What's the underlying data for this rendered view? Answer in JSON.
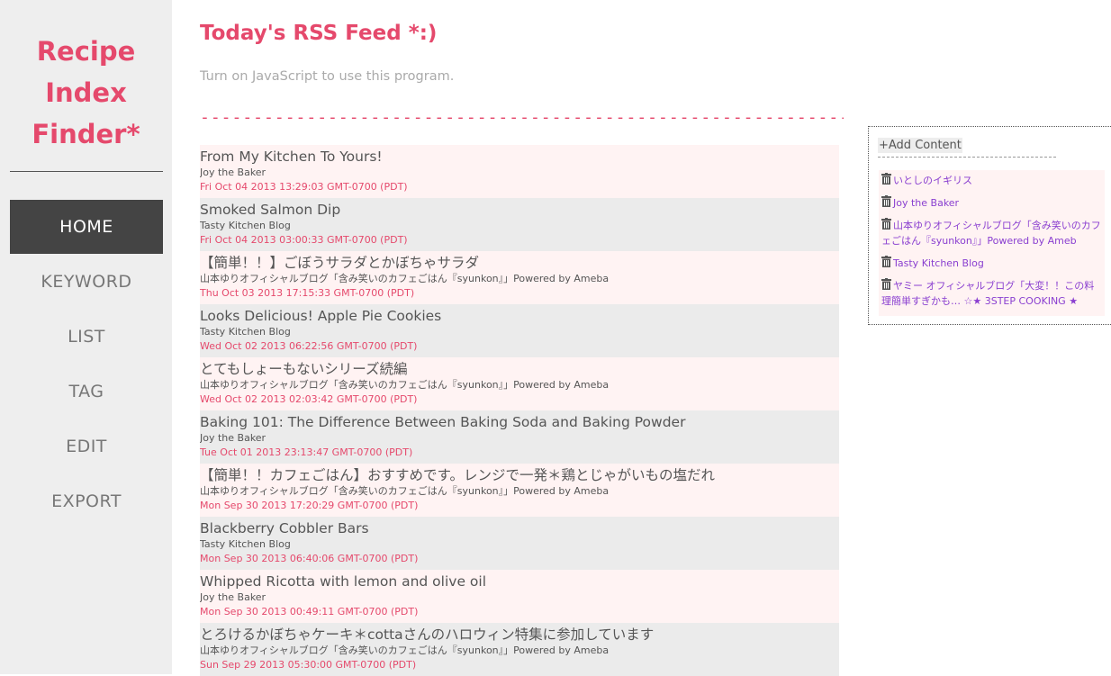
{
  "sidebar": {
    "logo_lines": [
      "Recipe",
      "Index",
      "Finder*"
    ],
    "nav": [
      {
        "label": "HOME",
        "active": true
      },
      {
        "label": "KEYWORD",
        "active": false
      },
      {
        "label": "LIST",
        "active": false
      },
      {
        "label": "TAG",
        "active": false
      },
      {
        "label": "EDIT",
        "active": false
      },
      {
        "label": "EXPORT",
        "active": false
      }
    ]
  },
  "main": {
    "title": "Today's RSS Feed *:)",
    "js_note": "Turn on JavaScript to use this program.",
    "divider": "--------------------------------------------------------------------------------",
    "feeds": [
      {
        "title": "From My Kitchen To Yours!",
        "source": "Joy the Baker",
        "date": "Fri Oct 04 2013 13:29:03 GMT-0700 (PDT)"
      },
      {
        "title": "Smoked Salmon Dip",
        "source": "Tasty Kitchen Blog",
        "date": "Fri Oct 04 2013 03:00:33 GMT-0700 (PDT)"
      },
      {
        "title": "【簡単！！】ごぼうサラダとかぼちゃサラダ",
        "source": "山本ゆりオフィシャルブログ「含み笑いのカフェごはん『syunkon』」Powered by Ameba",
        "date": "Thu Oct 03 2013 17:15:33 GMT-0700 (PDT)"
      },
      {
        "title": "Looks Delicious! Apple Pie Cookies",
        "source": "Tasty Kitchen Blog",
        "date": "Wed Oct 02 2013 06:22:56 GMT-0700 (PDT)"
      },
      {
        "title": "とてもしょーもないシリーズ続編",
        "source": "山本ゆりオフィシャルブログ「含み笑いのカフェごはん『syunkon』」Powered by Ameba",
        "date": "Wed Oct 02 2013 02:03:42 GMT-0700 (PDT)"
      },
      {
        "title": "Baking 101: The Difference Between Baking Soda and Baking Powder",
        "source": "Joy the Baker",
        "date": "Tue Oct 01 2013 23:13:47 GMT-0700 (PDT)"
      },
      {
        "title": "【簡単！！カフェごはん】おすすめです。レンジで一発＊鶏とじゃがいもの塩だれ",
        "source": "山本ゆりオフィシャルブログ「含み笑いのカフェごはん『syunkon』」Powered by Ameba",
        "date": "Mon Sep 30 2013 17:20:29 GMT-0700 (PDT)"
      },
      {
        "title": "Blackberry Cobbler Bars",
        "source": "Tasty Kitchen Blog",
        "date": "Mon Sep 30 2013 06:40:06 GMT-0700 (PDT)"
      },
      {
        "title": "Whipped Ricotta with lemon and olive oil",
        "source": "Joy the Baker",
        "date": "Mon Sep 30 2013 00:49:11 GMT-0700 (PDT)"
      },
      {
        "title": "とろけるかぼちゃケーキ＊cottaさんのハロウィン特集に参加しています",
        "source": "山本ゆりオフィシャルブログ「含み笑いのカフェごはん『syunkon』」Powered by Ameba",
        "date": "Sun Sep 29 2013 05:30:00 GMT-0700 (PDT)"
      }
    ]
  },
  "panel": {
    "add_label": "+Add Content",
    "subscriptions": [
      "いとしのイギリス",
      "Joy the Baker",
      "山本ゆりオフィシャルブログ「含み笑いのカフェごはん『syunkon』」Powered by Ameb",
      "Tasty Kitchen Blog",
      "ヤミー オフィシャルブログ「大変！！この料理簡単すぎかも… ☆★ 3STEP COOKING ★"
    ]
  },
  "colors": {
    "accent": "#e5496c",
    "sidebar_bg": "#eeeeee",
    "nav_active_bg": "#444444",
    "row_pink": "#fff3f3",
    "row_gray": "#ebebeb",
    "link_purple": "#8a3fd0"
  },
  "icons": {
    "subscription_remove": "trash-icon"
  }
}
